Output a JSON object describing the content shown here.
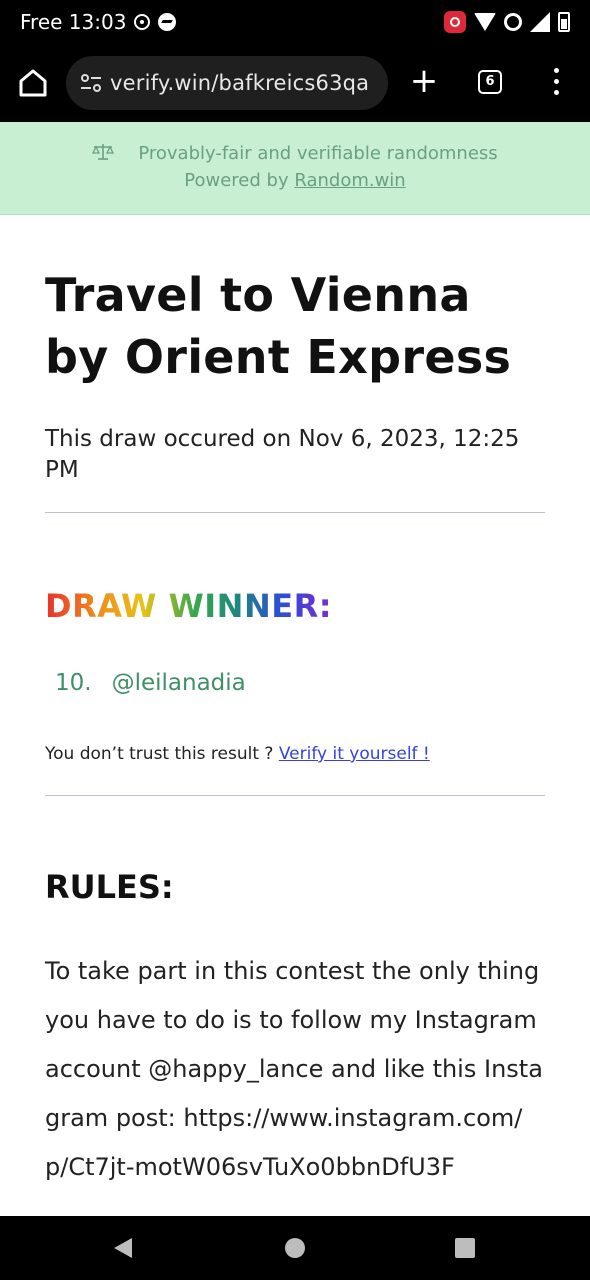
{
  "status_bar": {
    "carrier_time": "Free 13:03",
    "icons_left": [
      "settings-notification-icon",
      "messenger-icon"
    ],
    "icons_right": [
      "screen-record-icon",
      "wifi-icon",
      "data-saver-icon",
      "signal-icon",
      "battery-icon"
    ]
  },
  "browser": {
    "url": "verify.win/bafkreics63qa",
    "tab_count": "6",
    "new_tab_label": "+"
  },
  "banner": {
    "line1": "Provably-fair and verifiable randomness",
    "powered_prefix": "Powered by ",
    "powered_link": "Random.win",
    "background": "#c9efd3"
  },
  "draw": {
    "title": "Travel to Vienna by Orient Express",
    "date_text": "This draw occured on Nov 6, 2023, 12:25 PM",
    "winner_heading": "DRAW WINNER:",
    "winners": [
      {
        "number": "10.",
        "handle": "@leilanadia"
      }
    ],
    "trust_text": "You don’t trust this result ? ",
    "verify_link": "Verify it yourself !"
  },
  "rules": {
    "heading": "RULES:",
    "text": "To take part in this contest the only thing you have to do is to follow my Instagram account @happy_lance and like this Instagram post: https://www.instagram.com/p/Ct7jt-motW06svTuXo0bbnDfU3F"
  }
}
